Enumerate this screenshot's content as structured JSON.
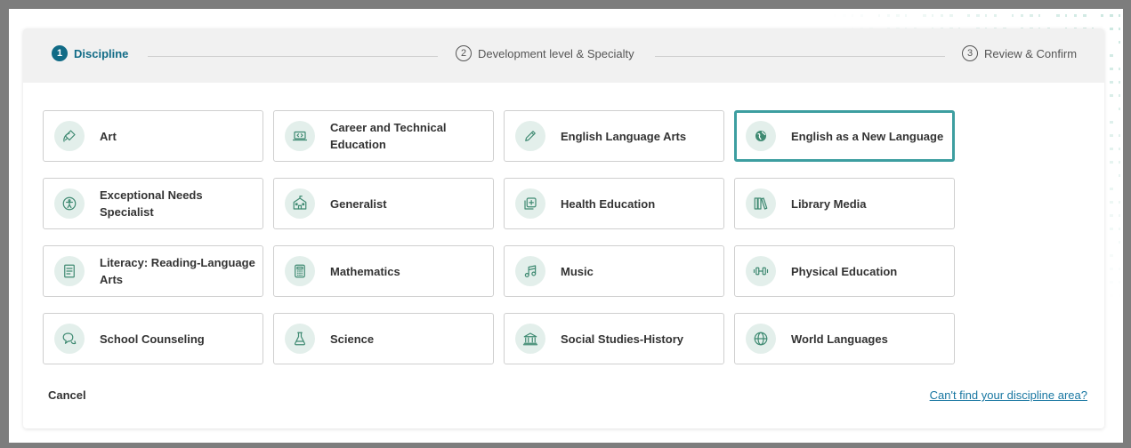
{
  "stepper": {
    "steps": [
      {
        "number": "1",
        "label": "Discipline"
      },
      {
        "number": "2",
        "label": "Development level & Specialty"
      },
      {
        "number": "3",
        "label": "Review & Confirm"
      }
    ]
  },
  "tiles": [
    {
      "label": "Art",
      "icon": "palette-brush-icon"
    },
    {
      "label": "Career and Technical Education",
      "icon": "laptop-code-icon"
    },
    {
      "label": "English Language Arts",
      "icon": "pencil-icon"
    },
    {
      "label": "English as a New Language",
      "icon": "globe-icon",
      "selected": true
    },
    {
      "label": "Exceptional Needs Specialist",
      "icon": "accessibility-icon"
    },
    {
      "label": "Generalist",
      "icon": "school-building-icon"
    },
    {
      "label": "Health Education",
      "icon": "health-plus-icon"
    },
    {
      "label": "Library Media",
      "icon": "books-icon"
    },
    {
      "label": "Literacy: Reading-Language Arts",
      "icon": "notebook-icon"
    },
    {
      "label": "Mathematics",
      "icon": "calculator-icon"
    },
    {
      "label": "Music",
      "icon": "music-note-icon"
    },
    {
      "label": "Physical Education",
      "icon": "dumbbell-icon"
    },
    {
      "label": "School Counseling",
      "icon": "chat-bubbles-icon"
    },
    {
      "label": "Science",
      "icon": "flask-icon"
    },
    {
      "label": "Social Studies-History",
      "icon": "museum-icon"
    },
    {
      "label": "World Languages",
      "icon": "world-icon"
    }
  ],
  "footer": {
    "cancel_label": "Cancel",
    "cant_find_label": "Can't find your discipline area?"
  },
  "colors": {
    "accent": "#116b86",
    "selected_border": "#3d9ea0",
    "icon_bg": "#e3efeb",
    "icon_stroke": "#3f8a72",
    "link": "#1776a1"
  }
}
